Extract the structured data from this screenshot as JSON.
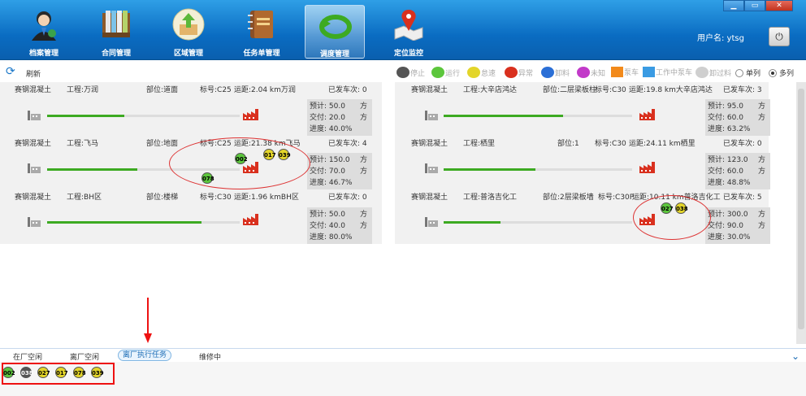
{
  "nav": [
    {
      "label": "档案管理",
      "icon": "user-archive-icon"
    },
    {
      "label": "合同管理",
      "icon": "books-icon"
    },
    {
      "label": "区域管理",
      "icon": "upload-box-icon"
    },
    {
      "label": "任务单管理",
      "icon": "notebook-icon"
    },
    {
      "label": "调度管理",
      "icon": "green-arrow-icon"
    },
    {
      "label": "定位监控",
      "icon": "map-pin-icon"
    }
  ],
  "user": {
    "label": "用户名: ytsg"
  },
  "window": {
    "min": "▁",
    "max": "▭",
    "close": "✕"
  },
  "toolbar": {
    "refresh": "刷新"
  },
  "legend": [
    {
      "label": "停止",
      "color": "#555555"
    },
    {
      "label": "运行",
      "color": "#5cc63c"
    },
    {
      "label": "怠速",
      "color": "#e3d52a"
    },
    {
      "label": "异常",
      "color": "#d9301e"
    },
    {
      "label": "卸料",
      "color": "#2b6fd6"
    },
    {
      "label": "未知",
      "color": "#c23ac9"
    },
    {
      "label": "泵车",
      "color": "#f28a1b"
    },
    {
      "label": "工作中泵车",
      "color": "#3a9be3"
    },
    {
      "label": "卸过料",
      "color": "#cfcfcf"
    }
  ],
  "view": {
    "single": "单列",
    "multi": "多列",
    "selected": "多列"
  },
  "left_rows": [
    {
      "company": "赛钢混凝土",
      "project": "工程:万润",
      "part": "部位:道面",
      "grade": "标号:C25",
      "distance": "运距:2.04 km万润",
      "sent": "已发车次: 0",
      "plan": "预计: 50.0",
      "delivered": "交付: 20.0",
      "progress_text": "进度: 40.0%",
      "progress": 0.4,
      "trucks": []
    },
    {
      "company": "赛钢混凝土",
      "project": "工程:飞马",
      "part": "部位:地面",
      "grade": "标号:C25",
      "distance": "运距:21.38 km飞马",
      "sent": "已发车次: 4",
      "plan": "预计: 150.0",
      "delivered": "交付: 70.0",
      "progress_text": "进度: 46.7%",
      "progress": 0.467,
      "trucks": [
        "002",
        "017",
        "039",
        "078"
      ]
    },
    {
      "company": "赛钢混凝土",
      "project": "工程:BH区",
      "part": "部位:楼梯",
      "grade": "标号:C30",
      "distance": "运距:1.96 kmBH区",
      "sent": "已发车次: 0",
      "plan": "预计: 50.0",
      "delivered": "交付: 40.0",
      "progress_text": "进度: 80.0%",
      "progress": 0.8,
      "trucks": []
    }
  ],
  "right_rows": [
    {
      "company": "赛钢混凝土",
      "project": "工程:大辛店鸿达",
      "part": "部位:二层梁板柱",
      "grade": "标号:C30",
      "distance": "运距:19.8 km大辛店鸿达",
      "sent": "已发车次: 3",
      "plan": "预计: 95.0",
      "delivered": "交付: 60.0",
      "progress_text": "进度: 63.2%",
      "progress": 0.632,
      "trucks": []
    },
    {
      "company": "赛钢混凝土",
      "project": "工程:栖里",
      "part": "部位:1",
      "grade": "标号:C30",
      "distance": "运距:24.11 km栖里",
      "sent": "已发车次: 0",
      "plan": "预计: 123.0",
      "delivered": "交付: 60.0",
      "progress_text": "进度: 48.8%",
      "progress": 0.488,
      "trucks": []
    },
    {
      "company": "赛钢混凝土",
      "project": "工程:普洛吉化工",
      "part": "部位:2层梁板墙",
      "grade": "标号:C30P",
      "distance": "运距:10.11 km普洛吉化工",
      "sent": "已发车次: 5",
      "plan": "预计: 300.0",
      "delivered": "交付: 90.0",
      "progress_text": "进度: 30.0%",
      "progress": 0.3,
      "trucks": [
        "027",
        "038"
      ]
    }
  ],
  "unit": "方",
  "bottom_tabs": [
    {
      "label": "在厂空闲"
    },
    {
      "label": "离厂空闲"
    },
    {
      "label": "离厂执行任务",
      "active": true
    },
    {
      "label": "维修中"
    }
  ],
  "bottom_trucks": [
    {
      "id": "002",
      "state": "运行"
    },
    {
      "id": "038",
      "state": "停止"
    },
    {
      "id": "027",
      "state": "怠速"
    },
    {
      "id": "017",
      "state": "怠速"
    },
    {
      "id": "078",
      "state": "怠速"
    },
    {
      "id": "039",
      "state": "怠速"
    }
  ],
  "truck_colors": {
    "002": "#5cc63c",
    "017": "#e3d52a",
    "039": "#e3d52a",
    "078": "#5cc63c",
    "027": "#5cc63c",
    "038": "#e3d52a"
  },
  "bottom_colors": {
    "002": "#5cc63c",
    "038": "#555555",
    "027": "#e3d52a",
    "017": "#e3d52a",
    "078": "#e3d52a",
    "039": "#e3d52a"
  }
}
